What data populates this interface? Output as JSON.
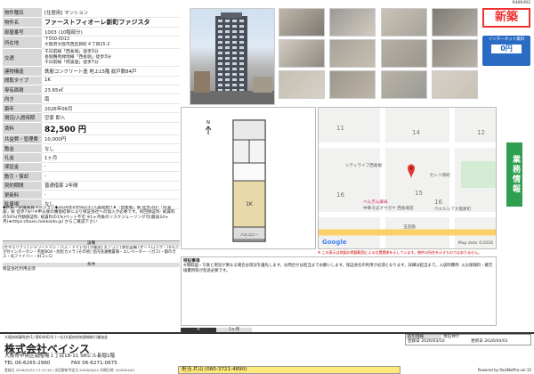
{
  "doc_id": "9466492",
  "title": "ファーストフィオーレ新町ファジスタ",
  "type_label": "[住居用] マンション",
  "spec": [
    {
      "label": "物件種目",
      "value": "[住居用] マンション"
    },
    {
      "label": "物件名",
      "value": "ファーストフィオーレ新町ファジスタ"
    },
    {
      "label": "部屋番号",
      "value": "1003 (10階部分)"
    },
    {
      "label": "所在地",
      "value": "〒550-0013\n大阪府大阪市西区新町４丁目15-2"
    },
    {
      "label": "交通",
      "value": "千日前線「西長堀」徒歩3分\n長堀鶴見緑地線「西長堀」徒歩3分\n千日前線「阿波座」徒歩7分"
    },
    {
      "label": "建物構造",
      "value": "鉄筋コンクリート造 地上15階 総戸数84戸"
    },
    {
      "label": "間取タイプ",
      "value": "1K"
    },
    {
      "label": "専有面積",
      "value": "23.65㎡"
    },
    {
      "label": "向き",
      "value": "南"
    },
    {
      "label": "築年",
      "value": "2026年06月"
    },
    {
      "label": "現況/入居時期",
      "value": "空家 即入"
    },
    {
      "label": "賃料",
      "value": "82,500 円"
    },
    {
      "label": "共益費・管理費",
      "value": "10,000円"
    },
    {
      "label": "敷金",
      "value": "なし"
    },
    {
      "label": "礼金",
      "value": "1ヶ月"
    },
    {
      "label": "保証金",
      "value": "-"
    },
    {
      "label": "敷引・償却",
      "value": "-"
    },
    {
      "label": "契約期間",
      "value": "普通借家 2年間"
    },
    {
      "label": "更新料",
      "value": "-"
    },
    {
      "label": "駐車場",
      "value": "なし"
    }
  ],
  "row_labels": {
    "orientation_balcony": "バルコニー方位",
    "orientation_value": "南",
    "status_badge": "空家",
    "status_move": "即入",
    "rent_amount": "82,500",
    "rent_unit": "円",
    "shiki_label": "敷引",
    "shokyaku_label": "償却"
  },
  "notes_text": "◆新築・分譲賃貸マンション◆2026年6月9日(火)入居開始!!★「西長堀」駅 徒歩3分!「阿波座」駅 徒歩7分!!※申込後の審査結果により保証会社への加入が必要です。初回保証料: 総賃料の50%(月額保証料: 総賃料の1%)ペット不可 ※1ヶ月後のリスケジューリング可(最長24ヶ月)★https://basis.hokkaido.jp/ からご確認下さい",
  "equipment_label": "設備",
  "equipment_text": "[セキュリティ] シャワートイレ・バス・トイレ別 [冷暖房] エアコン [防犯設備] オートロック・TVモニタ付インターホン・宅配BOX・防犯カメラ [その他] 室内洗濯機置場・エレベーター・(ガス)・都市ガス・光ファイバー・IHコンロ",
  "conditions_label": "条件",
  "conditions_text": "保証会社利用必須",
  "remarks_label": "特記事項",
  "remarks_text": "※間取図・写真と現況が異なる場合は現況を優先します。お問合せは担当までお願いします。保証会社の利用が必須となります。詳細は担当まで。入居時費用: 火災保険料・鍵交換費用等が別途必要です。",
  "new_badge": "新築",
  "internet_badge": "インターネット無料",
  "internet_fee": "0円",
  "side_tab": "業務情報",
  "map_place_1": "シティライフ西長堀",
  "map_place_2": "セレソ新町",
  "map_place_3": "べんぎん薬局",
  "map_place_4": "中華そばガヤガヤ 西長堀店",
  "map_place_5": "ウエルシア大阪新町",
  "map_road": "玉造筋",
  "map_copyright": "Map data ©2026",
  "map_credit": "Google",
  "map_note": "※ この表示は地図の掲載範囲による位置関係を示しています。物件の所在を示すものではありません。",
  "floor_plan_label": "間取図",
  "plan_label": "1K",
  "balcony": "バルコニー",
  "footer_top": "大阪府知事免許(1) 第64462号 (一社)大阪府宅地建物取引業協会",
  "company_name": "株式会社ベイシス",
  "company_address": "大阪市中央区南船場１丁目18-11 SRビル長堀1階",
  "tel": "TEL 06-6265-2960",
  "fax": "FAX 06-6271-0675",
  "register_date": "登録日 2026/03/10",
  "update_date": "更新日 2026/04/01",
  "staff_label": "担当者",
  "staff_name": "担当 片山 (080-3721-4890)",
  "fee_label": "取引態様",
  "fee_value": "専任仲介",
  "footer_print": "登録日 2026/03/10 17:15:16 / 次回更新予定日 2026/06/21 印刷日時: 2026/04/01",
  "footer_power": "Powered by RealNetPro.ver.15",
  "agent_lines": [
    "担当:片山 (080-3721-4890)",
    "Powered by RealNetPro.ver.15"
  ],
  "bottom_strip_a": "A",
  "bottom_strip_b": "1ヶ月"
}
